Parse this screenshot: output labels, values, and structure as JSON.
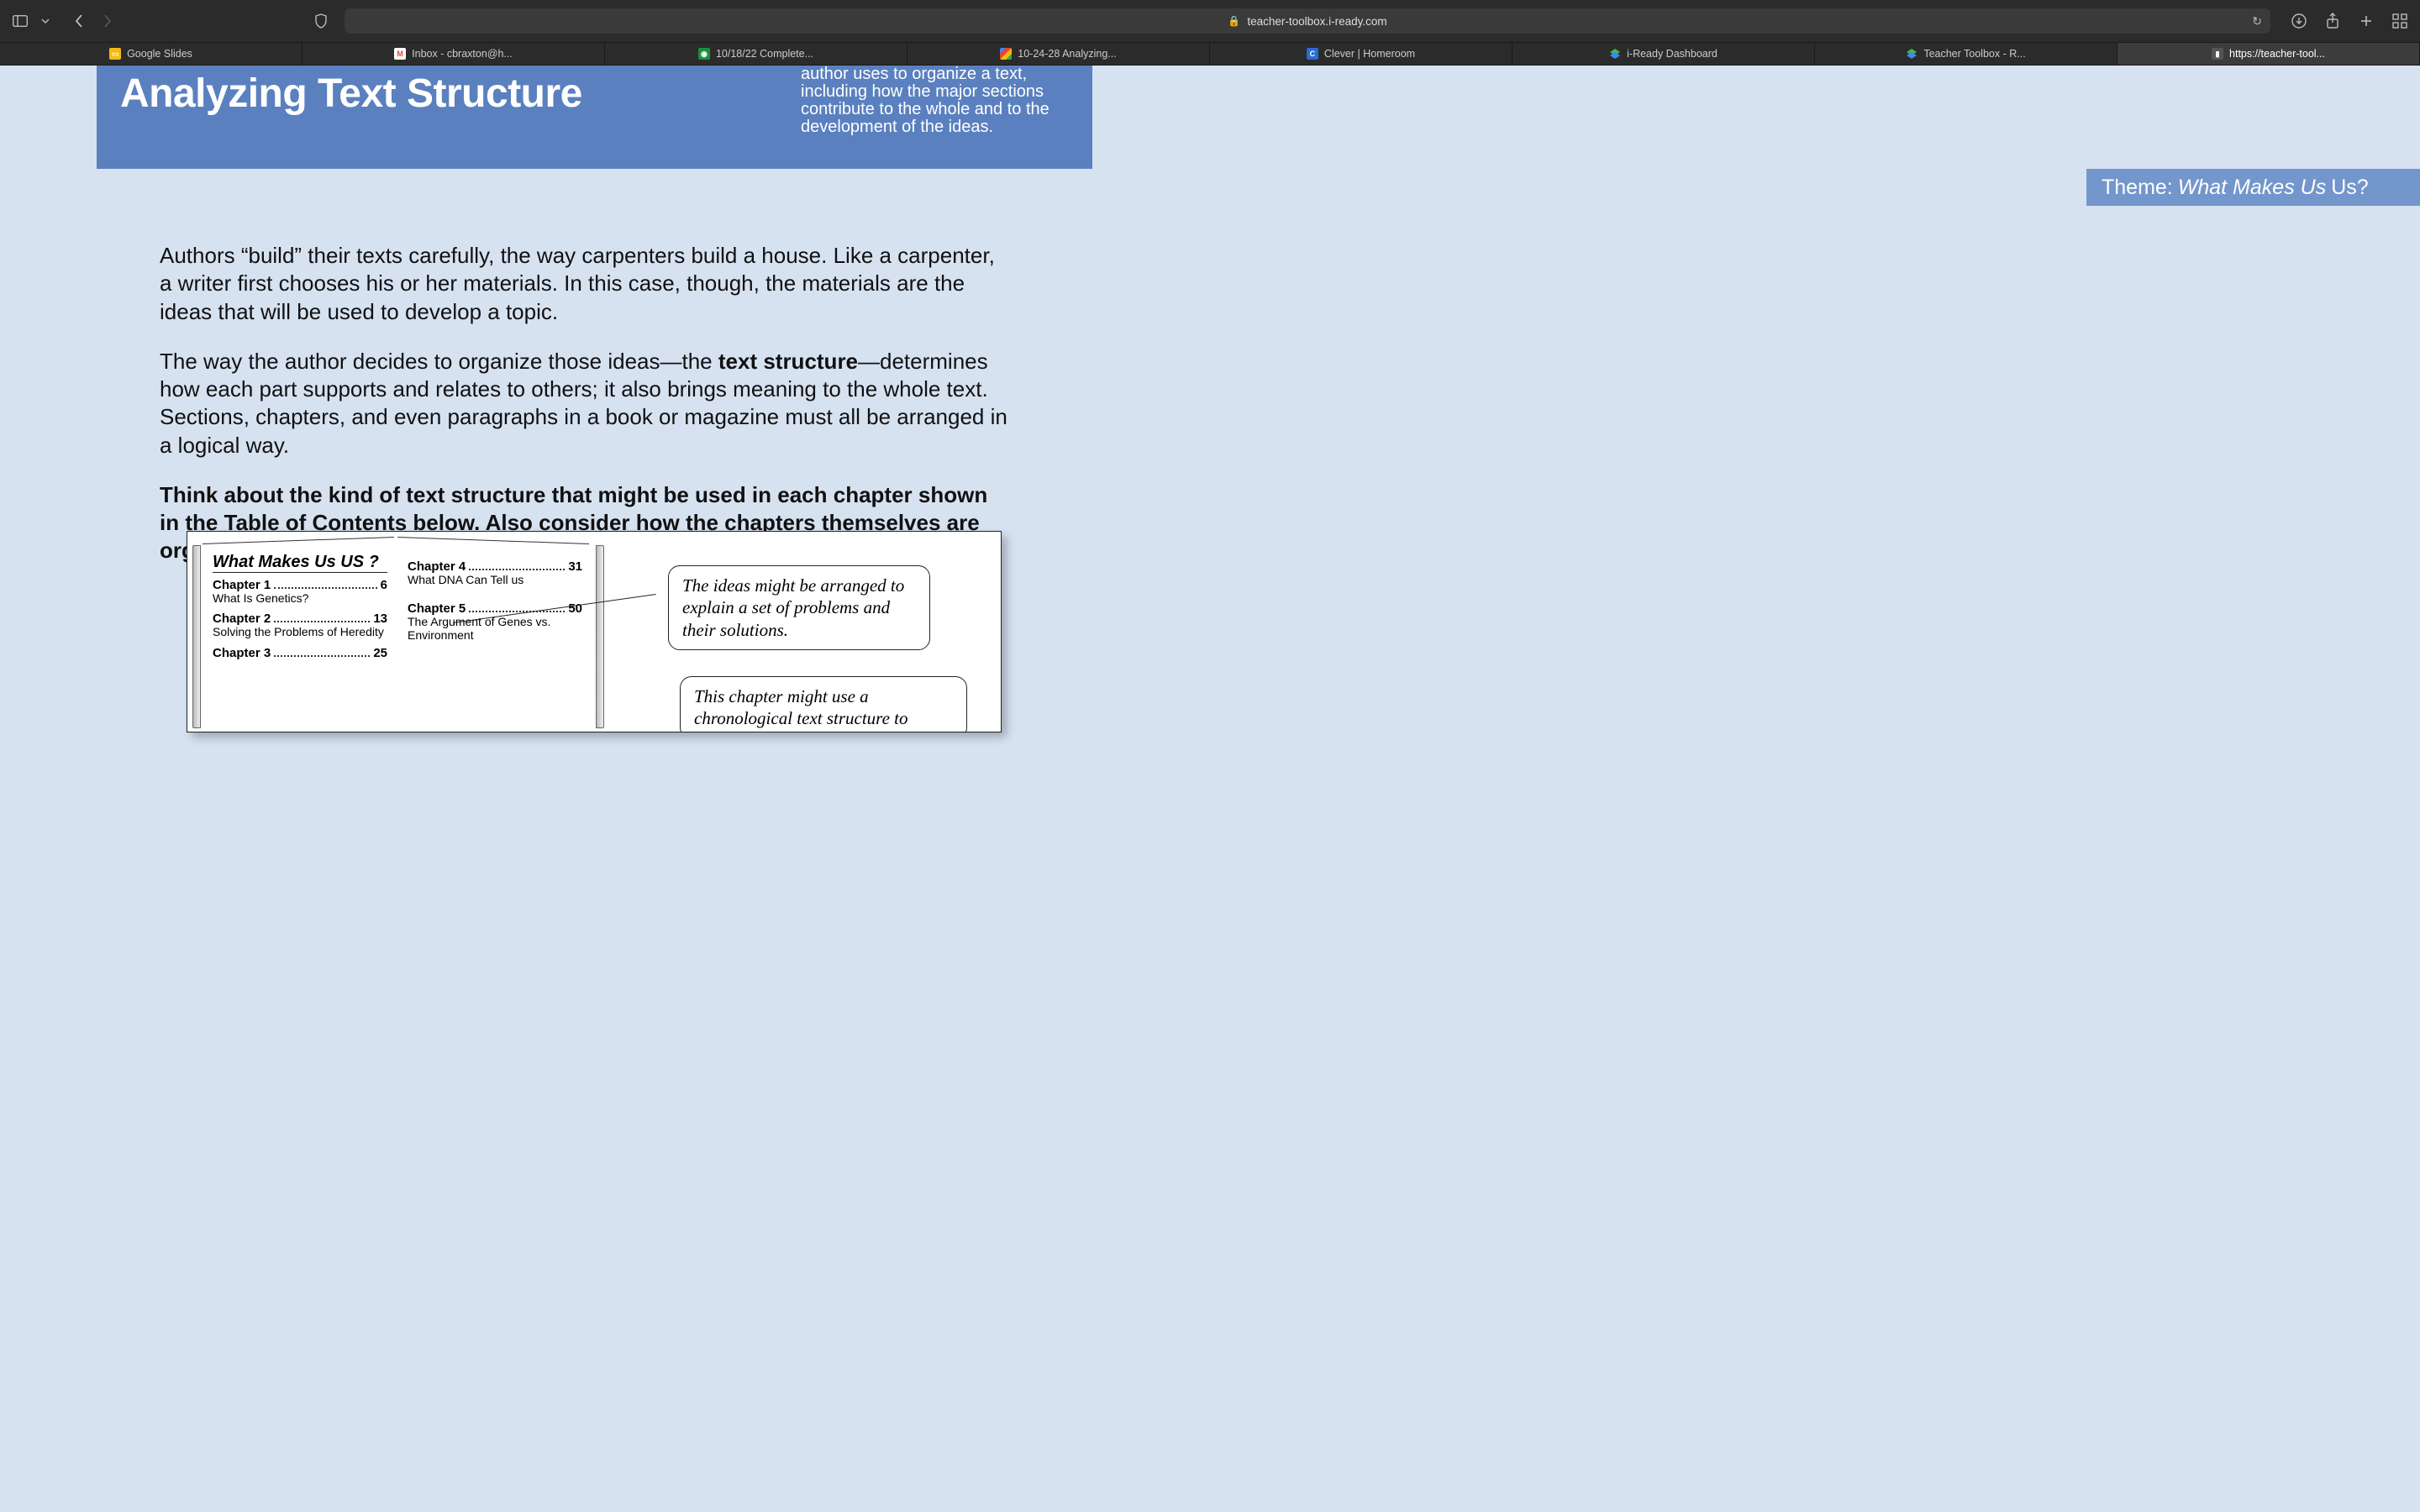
{
  "browser": {
    "url": "teacher-toolbox.i-ready.com",
    "tabs": [
      {
        "label": "Google Slides",
        "favicon": "slides"
      },
      {
        "label": "Inbox - cbraxton@h...",
        "favicon": "gmail"
      },
      {
        "label": "10/18/22 Complete...",
        "favicon": "doc"
      },
      {
        "label": "10-24-28 Analyzing...",
        "favicon": "google"
      },
      {
        "label": "Clever | Homeroom",
        "favicon": "clever"
      },
      {
        "label": "i-Ready Dashboard",
        "favicon": "iready"
      },
      {
        "label": "Teacher Toolbox - R...",
        "favicon": "iready"
      },
      {
        "label": "https://teacher-tool...",
        "favicon": "toolbox",
        "active": true
      }
    ]
  },
  "lesson": {
    "title": "Analyzing Text Structure",
    "objective_fragment": "author uses to organize a text, including how the major sections contribute to the whole and to the development of the ideas.",
    "theme_label": "Theme:",
    "theme_italic": "What Makes Us",
    "theme_tail": "Us?"
  },
  "body": {
    "p1": "Authors “build” their texts carefully, the way carpenters build a house. Like a carpenter, a writer first chooses his or her materials. In this case, though, the materials are the ideas that will be used to develop a topic.",
    "p2_a": "The way the author decides to organize those ideas—the ",
    "p2_bold": "text structure",
    "p2_b": "—determines how each part supports and relates to others; it also brings meaning to the whole text. Sections, chapters, and even paragraphs in a book or magazine must all be arranged in a logical way.",
    "p3": "Think about the kind of text structure that might be used in each chapter shown in the Table of Contents below. Also consider how the chapters themselves are organized."
  },
  "book": {
    "title": "What Makes Us US ?",
    "left": [
      {
        "chapter": "Chapter 1",
        "page": "6",
        "sub": "What Is Genetics?"
      },
      {
        "chapter": "Chapter 2",
        "page": "13",
        "sub": "Solving the Problems of Heredity"
      },
      {
        "chapter": "Chapter 3",
        "page": "25",
        "sub": ""
      }
    ],
    "right": [
      {
        "chapter": "Chapter 4",
        "page": "31",
        "sub": "What DNA Can Tell us"
      },
      {
        "chapter": "Chapter 5",
        "page": "50",
        "sub": "The Argument of Genes vs. Environment"
      }
    ]
  },
  "callouts": {
    "c1": "The ideas might be arranged to explain a set of problems and their solutions.",
    "c2": "This chapter might use a chronological text structure to"
  }
}
